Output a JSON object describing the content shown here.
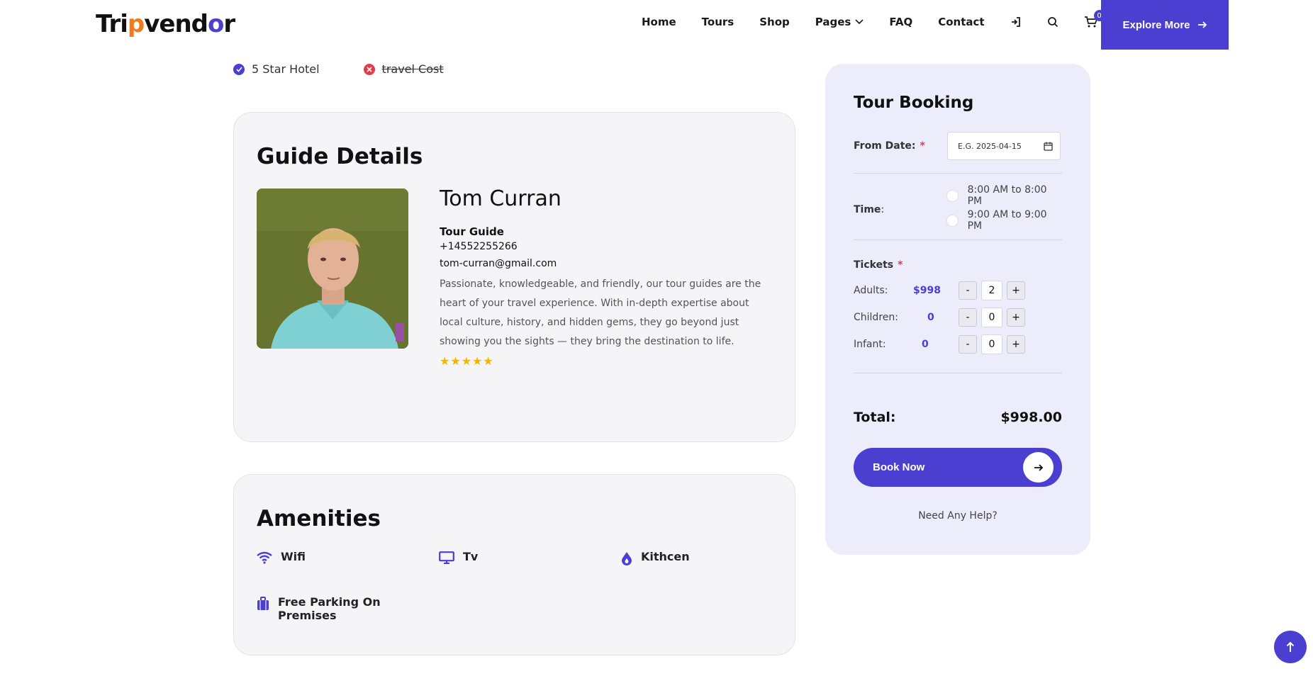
{
  "header": {
    "logo": {
      "part1": "Tri",
      "part2": "p",
      "part3": "vend",
      "part4": "o",
      "part5": "r"
    },
    "nav": [
      "Home",
      "Tours",
      "Shop",
      "Pages",
      "FAQ",
      "Contact"
    ],
    "cart_count": "0",
    "explore_label": "Explore More"
  },
  "includes": {
    "included": "5 Star Hotel",
    "excluded": "travel Cost"
  },
  "guide": {
    "section_title": "Guide Details",
    "name": "Tom Curran",
    "role": "Tour Guide",
    "phone": "+14552255266",
    "email": "tom-curran@gmail.com",
    "bio": "Passionate, knowledgeable, and friendly, our tour guides are the heart of your travel experience. With in-depth expertise about local culture, history, and hidden gems, they go beyond just showing you the sights — they bring the destination to life.",
    "rating": 5
  },
  "amenities": {
    "section_title": "Amenities",
    "items": [
      {
        "label": "Wifi",
        "icon": "wifi-icon"
      },
      {
        "label": "Tv",
        "icon": "tv-icon"
      },
      {
        "label": "Kithcen",
        "icon": "flame-icon"
      },
      {
        "label": "Free Parking On Premises",
        "icon": "luggage-icon"
      }
    ]
  },
  "booking": {
    "title": "Tour Booking",
    "from_date_label": "From Date:",
    "required_mark": "*",
    "date_placeholder": "E.G. 2025-04-15",
    "time_label": "Time",
    "time_suffix": ":",
    "time_options": [
      "8:00 AM to 8:00 PM",
      "9:00 AM to 9:00 PM"
    ],
    "tickets_label": "Tickets",
    "tickets": [
      {
        "label": "Adults:",
        "price": "$998",
        "qty": "2"
      },
      {
        "label": "Children:",
        "price": "0",
        "qty": "0"
      },
      {
        "label": "Infant:",
        "price": "0",
        "qty": "0"
      }
    ],
    "minus": "-",
    "plus": "+",
    "total_label": "Total:",
    "total_value": "$998.00",
    "book_label": "Book Now",
    "help": "Need Any Help?"
  },
  "colors": {
    "accent": "#4b3fd1",
    "star": "#f5b400",
    "required": "#e23b4a"
  }
}
